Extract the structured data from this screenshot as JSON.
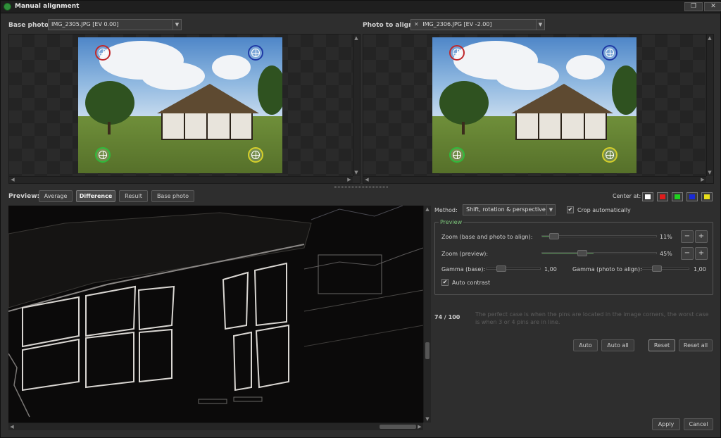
{
  "window": {
    "title": "Manual alignment",
    "restore_glyph": "❐",
    "close_glyph": "✕"
  },
  "base": {
    "label": "Base photo:",
    "value": "IMG_2305.JPG [EV 0.00]"
  },
  "align": {
    "label": "Photo to align:",
    "value": "IMG_2306.JPG [EV -2.00]",
    "remove_glyph": "✕"
  },
  "pins": [
    {
      "color": "#c0282b",
      "icon": "red-pin-icon"
    },
    {
      "color": "#1f3aa6",
      "icon": "blue-pin-icon"
    },
    {
      "color": "#2dbb3b",
      "icon": "green-pin-icon"
    },
    {
      "color": "#d6cf2a",
      "icon": "yellow-pin-icon"
    }
  ],
  "preview_bar": {
    "label": "Preview:",
    "tabs": [
      {
        "label": "Average",
        "active": false
      },
      {
        "label": "Difference",
        "active": true
      },
      {
        "label": "Result",
        "active": false
      },
      {
        "label": "Base photo",
        "active": false
      }
    ],
    "center_label": "Center at:",
    "center_colors": [
      "#ffffff",
      "#e01c1c",
      "#1fd31f",
      "#1a2bd8",
      "#e8df1b"
    ]
  },
  "method": {
    "label": "Method:",
    "value": "Shift, rotation & perspective"
  },
  "crop": {
    "label": "Crop automatically",
    "checked": true
  },
  "preview_group": {
    "title": "Preview",
    "zoom_base": {
      "label": "Zoom (base and photo to align):",
      "value": "11%",
      "level": 0.11
    },
    "zoom_preview": {
      "label": "Zoom (preview):",
      "value": "45%",
      "level": 0.45
    },
    "gamma_base": {
      "label": "Gamma (base):",
      "value": "1,00"
    },
    "gamma_align": {
      "label": "Gamma (photo to align):",
      "value": "1,00"
    },
    "auto_contrast": {
      "label": "Auto contrast",
      "checked": true
    },
    "zoom_out_glyph": "−",
    "zoom_in_glyph": "+"
  },
  "score": {
    "value": "74 / 100",
    "hint": "The perfect case is when the pins are located in the image corners, the worst case is when 3 or 4 pins are in line."
  },
  "buttons": {
    "auto": "Auto",
    "auto_all": "Auto all",
    "reset": "Reset",
    "reset_all": "Reset all",
    "apply": "Apply",
    "cancel": "Cancel"
  },
  "check_glyph": "✔"
}
